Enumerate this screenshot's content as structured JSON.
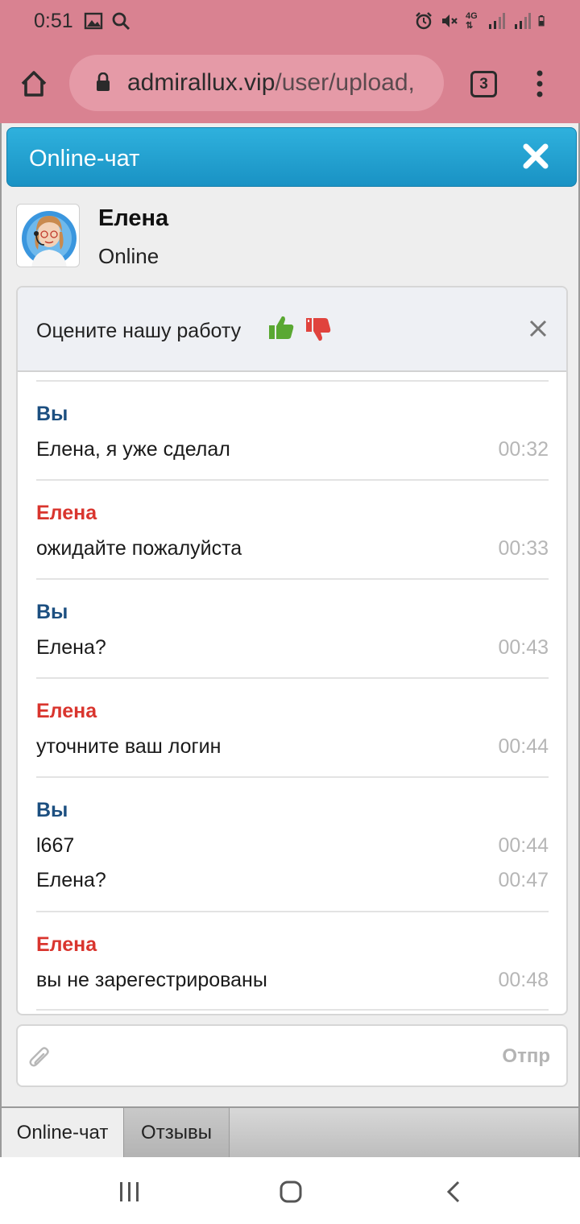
{
  "status_bar": {
    "time": "0:51",
    "left_icons": [
      "gallery-icon",
      "search-icon"
    ],
    "right_icons": [
      "alarm-icon",
      "mute-icon",
      "4g-icon",
      "signal-icon",
      "signal-icon-2",
      "battery-icon"
    ],
    "network_label": "4G"
  },
  "browser": {
    "url_host": "admirallux.vip",
    "url_path": "/user/upload,",
    "tab_count": "3"
  },
  "widget": {
    "title": "Online-чат",
    "agent": {
      "name": "Елена",
      "status": "Online"
    },
    "rating": {
      "prompt": "Оцените нашу работу"
    },
    "messages": [
      {
        "sender": "Вы",
        "role": "you",
        "lines": [
          {
            "text": "Елена, я уже сделал",
            "time": "00:32"
          }
        ]
      },
      {
        "sender": "Елена",
        "role": "agent",
        "lines": [
          {
            "text": "ожидайте пожалуйста",
            "time": "00:33"
          }
        ]
      },
      {
        "sender": "Вы",
        "role": "you",
        "lines": [
          {
            "text": "Елена?",
            "time": "00:43"
          }
        ]
      },
      {
        "sender": "Елена",
        "role": "agent",
        "lines": [
          {
            "text": "уточните ваш логин",
            "time": "00:44"
          }
        ]
      },
      {
        "sender": "Вы",
        "role": "you",
        "lines": [
          {
            "text": "l667",
            "time": "00:44"
          },
          {
            "text": "Елена?",
            "time": "00:47"
          }
        ]
      },
      {
        "sender": "Елена",
        "role": "agent",
        "lines": [
          {
            "text": "вы не зарегестрированы",
            "time": "00:48"
          }
        ]
      }
    ],
    "input": {
      "send_label": "Отпр",
      "placeholder": ""
    },
    "tabs": [
      {
        "label": "Online-чат",
        "active": true
      },
      {
        "label": "Отзывы",
        "active": false
      }
    ]
  },
  "colors": {
    "browser_bar": "#d98291",
    "header_blue": "#1f9fd0",
    "you_sender": "#1c4f80",
    "agent_sender": "#d9352e",
    "thumb_up": "#5aa832",
    "thumb_down": "#e0433d"
  }
}
